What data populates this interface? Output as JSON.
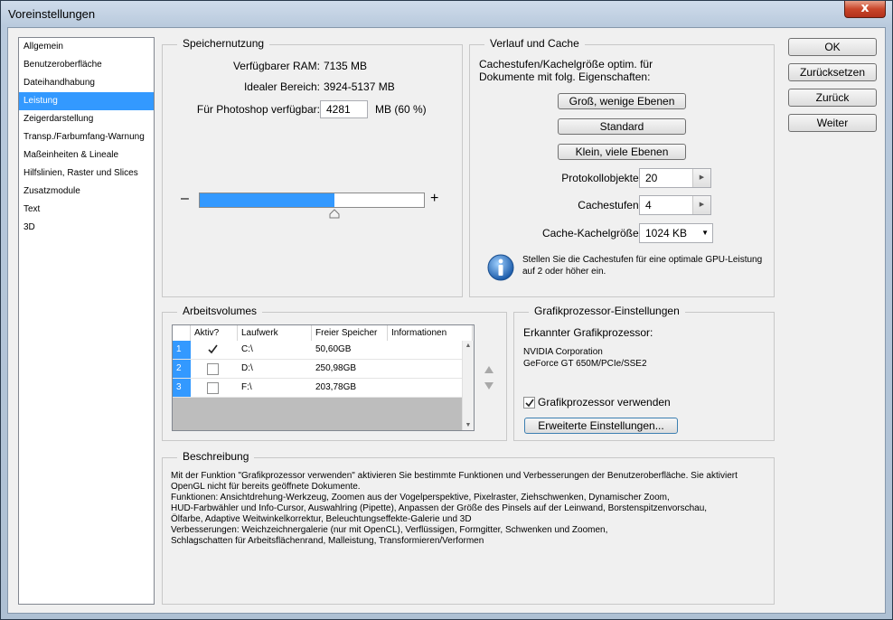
{
  "window": {
    "title": "Voreinstellungen",
    "close_glyph": "x"
  },
  "sidebar": {
    "items": [
      {
        "label": "Allgemein",
        "selected": false
      },
      {
        "label": "Benutzeroberfläche",
        "selected": false
      },
      {
        "label": "Dateihandhabung",
        "selected": false
      },
      {
        "label": "Leistung",
        "selected": true
      },
      {
        "label": "Zeigerdarstellung",
        "selected": false
      },
      {
        "label": "Transp./Farbumfang-Warnung",
        "selected": false
      },
      {
        "label": "Maßeinheiten & Lineale",
        "selected": false
      },
      {
        "label": "Hilfslinien, Raster und Slices",
        "selected": false
      },
      {
        "label": "Zusatzmodule",
        "selected": false
      },
      {
        "label": "Text",
        "selected": false
      },
      {
        "label": "3D",
        "selected": false
      }
    ]
  },
  "buttons": {
    "ok": "OK",
    "reset": "Zurücksetzen",
    "back": "Zurück",
    "next": "Weiter"
  },
  "speicher": {
    "legend": "Speichernutzung",
    "ram_label": "Verfügbarer RAM:",
    "ram_value": "7135 MB",
    "ideal_label": "Idealer Bereich:",
    "ideal_value": "3924-5137 MB",
    "ps_label": "Für Photoshop verfügbar:",
    "ps_value": "4281",
    "ps_unit": "MB (60 %)",
    "slider_fraction": 0.6,
    "minus": "–",
    "plus": "+"
  },
  "cache": {
    "legend": "Verlauf und Cache",
    "desc_line1": "Cachestufen/Kachelgröße optim. für",
    "desc_line2": "Dokumente mit folg. Eigenschaften:",
    "btn_large": "Groß, wenige Ebenen",
    "btn_standard": "Standard",
    "btn_small": "Klein, viele Ebenen",
    "history_label": "Protokollobjekte:",
    "history_value": "20",
    "levels_label": "Cachestufen:",
    "levels_value": "4",
    "tile_label": "Cache-Kachelgröße:",
    "tile_value": "1024 KB",
    "info_line1": "Stellen Sie die Cachestufen für eine optimale GPU-Leistung",
    "info_line2": "auf 2 oder höher ein."
  },
  "volumes": {
    "legend": "Arbeitsvolumes",
    "headers": [
      "Aktiv?",
      "Laufwerk",
      "Freier Speicher",
      "Informationen"
    ],
    "rows": [
      {
        "num": "1",
        "active": true,
        "drive": "C:\\",
        "free": "50,60GB",
        "info": ""
      },
      {
        "num": "2",
        "active": false,
        "drive": "D:\\",
        "free": "250,98GB",
        "info": ""
      },
      {
        "num": "3",
        "active": false,
        "drive": "F:\\",
        "free": "203,78GB",
        "info": ""
      }
    ]
  },
  "gpu": {
    "legend": "Grafikprozessor-Einstellungen",
    "detected_label": "Erkannter Grafikprozessor:",
    "vendor": "NVIDIA Corporation",
    "model": "GeForce GT 650M/PCIe/SSE2",
    "use_label": "Grafikprozessor verwenden",
    "use_checked": true,
    "advanced": "Erweiterte Einstellungen..."
  },
  "beschreibung": {
    "legend": "Beschreibung",
    "lines": [
      "Mit der Funktion \"Grafikprozessor verwenden\" aktivieren Sie bestimmte Funktionen und Verbesserungen der Benutzeroberfläche. Sie aktiviert",
      "OpenGL nicht für bereits geöffnete Dokumente.",
      "Funktionen: Ansichtdrehung-Werkzeug, Zoomen aus der Vogelperspektive, Pixelraster, Ziehschwenken, Dynamischer Zoom,",
      "HUD-Farbwähler und Info-Cursor, Auswahlring (Pipette), Anpassen der Größe des Pinsels auf der Leinwand, Borstenspitzenvorschau,",
      "Ölfarbe, Adaptive Weitwinkelkorrektur, Beleuchtungseffekte-Galerie und 3D",
      "Verbesserungen: Weichzeichnergalerie (nur mit OpenCL), Verflüssigen, Formgitter, Schwenken und Zoomen,",
      "Schlagschatten für Arbeitsflächenrand, Malleistung, Transformieren/Verformen"
    ]
  },
  "colors": {
    "accent": "#3399ff",
    "dialog_bg": "#f0f0f0"
  }
}
